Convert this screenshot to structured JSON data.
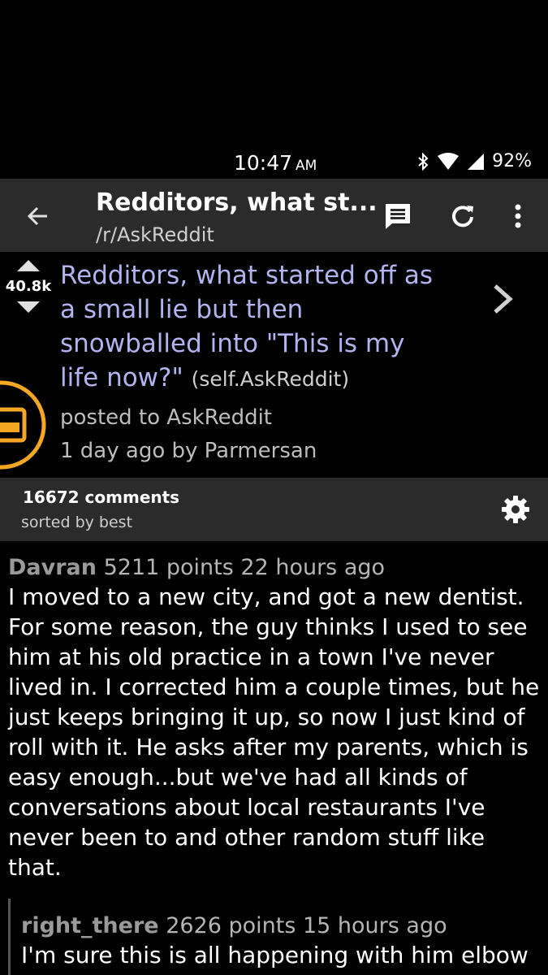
{
  "status": {
    "time": "10:47",
    "ampm": "AM",
    "battery": "92%"
  },
  "toolbar": {
    "title": "Redditors, what st...",
    "subreddit": "/r/AskReddit"
  },
  "post": {
    "score": "40.8k",
    "title": "Redditors, what started off as a small lie but then snowballed into \"This is my life now?\"",
    "domain": "(self.AskReddit)",
    "posted_to": "posted to AskReddit",
    "age_author": "1 day ago by Parmersan"
  },
  "comments_header": {
    "count": "16672 comments",
    "sort": "sorted by best"
  },
  "comments": [
    {
      "author": "Davran",
      "meta": "5211 points 22 hours ago",
      "body": "I moved to a new city, and got a new dentist. For some reason, the guy thinks I used to see him at his old practice in a town I've never lived in. I corrected him a couple times, but he just keeps bringing it up, so now I just kind of roll with it. He asks after my parents, which is easy enough...but we've had all kinds of conversations about local restaurants I've never been to and other random stuff like that."
    },
    {
      "author": "right_there",
      "meta": "2626 points 15 hours ago",
      "body": "I'm sure this is all happening with him elbow"
    }
  ],
  "colors": {
    "toolbar_bg": "#2b2b2b",
    "title_link": "#b3b3f0",
    "thumb_orange": "#f5a623"
  },
  "icons": [
    "back-arrow",
    "comment",
    "refresh",
    "more-vert",
    "upvote",
    "downvote",
    "chevron-right",
    "gear",
    "bluetooth",
    "wifi",
    "signal",
    "battery"
  ]
}
